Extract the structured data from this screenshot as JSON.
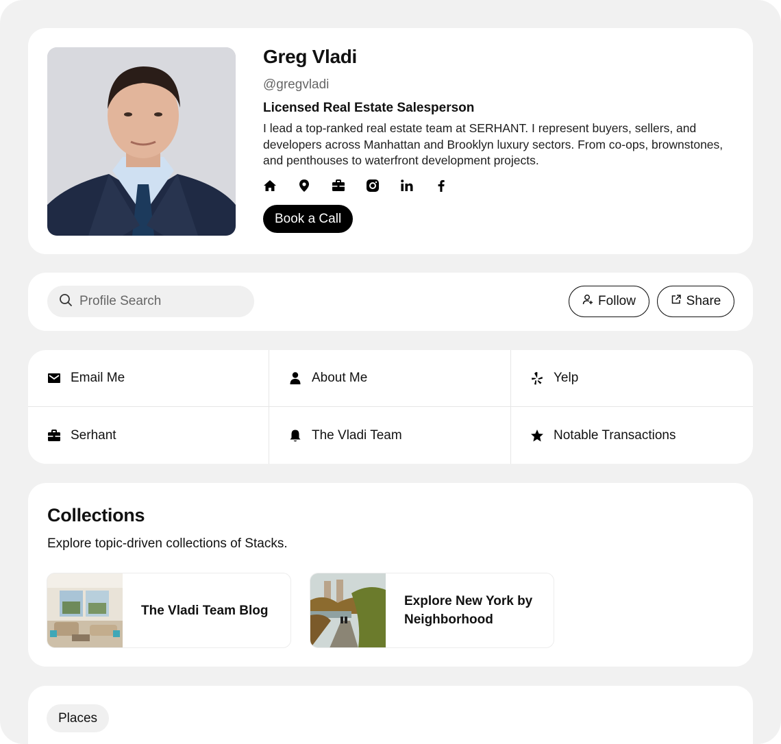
{
  "profile": {
    "name": "Greg Vladi",
    "handle": "@gregvladi",
    "role": "Licensed Real Estate Salesperson",
    "bio": "I lead a top-ranked real estate team at SERHANT. I represent buyers, sellers, and developers across Manhattan and Brooklyn luxury sectors. From co-ops, brownstones, and penthouses to waterfront development projects.",
    "social_icons": [
      "home-icon",
      "location-pin-icon",
      "briefcase-icon",
      "instagram-icon",
      "linkedin-icon",
      "facebook-icon"
    ],
    "cta_label": "Book a Call"
  },
  "toolbar": {
    "search_placeholder": "Profile Search",
    "follow_label": "Follow",
    "share_label": "Share"
  },
  "links": [
    {
      "label": "Email Me",
      "icon": "envelope-icon"
    },
    {
      "label": "About Me",
      "icon": "person-icon"
    },
    {
      "label": "Yelp",
      "icon": "yelp-icon"
    },
    {
      "label": "Serhant",
      "icon": "briefcase-icon"
    },
    {
      "label": "The Vladi Team",
      "icon": "bell-icon"
    },
    {
      "label": "Notable Transactions",
      "icon": "star-icon"
    }
  ],
  "collections": {
    "title": "Collections",
    "subtitle": "Explore topic-driven collections of Stacks.",
    "items": [
      {
        "label": "The Vladi Team Blog"
      },
      {
        "label": "Explore New York by Neighborhood"
      }
    ]
  },
  "places": {
    "chip_label": "Places"
  },
  "colors": {
    "background": "#f1f1f1",
    "card": "#ffffff",
    "accent": "#000000"
  }
}
